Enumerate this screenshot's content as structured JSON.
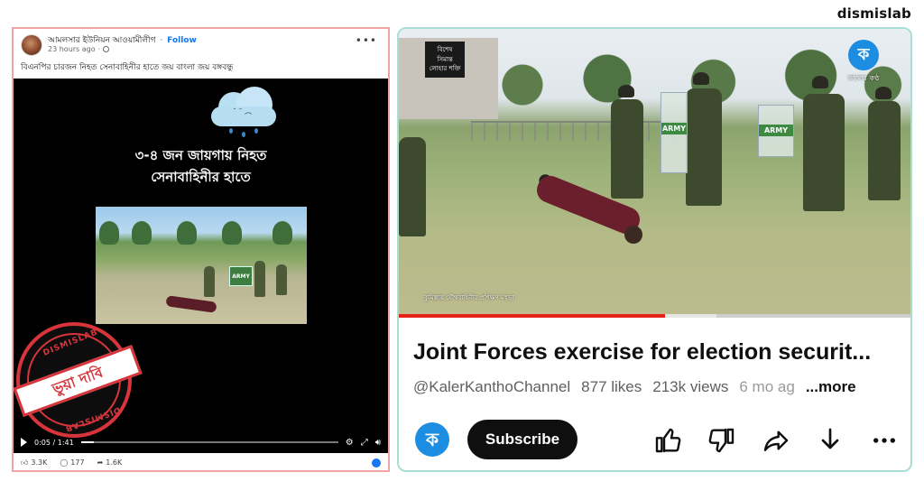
{
  "brand": {
    "name": "dismislab"
  },
  "facebook": {
    "page_name": "আমলসার ইউনিয়ন আওয়ামীলীগ",
    "follow_label": "Follow",
    "timestamp": "23 hours ago",
    "caption": "বিএনপির চারজন নিহত সেনাবাহিনীর হাতে জয় বাংলা জয় বঙ্গবন্ধু",
    "overlay_line1": "৩-৪ জন জায়গায় নিহত",
    "overlay_line2": "সেনাবাহিনীর হাতে",
    "shield_text": "ARMY",
    "stamp_top": "DISMISLAB",
    "stamp_bottom": "DISMISLAB",
    "stamp_label": "ভুয়া দাবি",
    "video_time": "0:05 / 1:41",
    "progress_fraction": 0.05,
    "reactions": {
      "likes": "3.3K",
      "comments": "177",
      "shares": "1.6K"
    },
    "icons": [
      "globe-icon",
      "more-icon",
      "play-icon",
      "settings-icon",
      "fullscreen-icon",
      "volume-icon",
      "like-icon",
      "comment-icon",
      "share-icon"
    ]
  },
  "youtube": {
    "tl_logo_line1": "বিশেষ",
    "tl_logo_line2": "সিমান্ত",
    "tl_logo_line3": "লোহার শক্তি",
    "tr_logo_letter": "ক",
    "tr_logo_name": "কালের কণ্ঠ",
    "shield_text": "ARMY",
    "watermark": "কুমিল্লায় যৌথবাহিনীর প্রশিক্ষণ মহড়া",
    "progress_fraction": 0.52,
    "title": "Joint Forces exercise for election securit...",
    "channel": "@KalerKanthoChannel",
    "likes": "877 likes",
    "views": "213k views",
    "age": "6 mo ag",
    "more_label": "...more",
    "subscribe_label": "Subscribe",
    "channel_logo_letter": "ক",
    "actions": [
      "like-icon",
      "dislike-icon",
      "share-icon",
      "download-icon",
      "more-icon"
    ]
  }
}
